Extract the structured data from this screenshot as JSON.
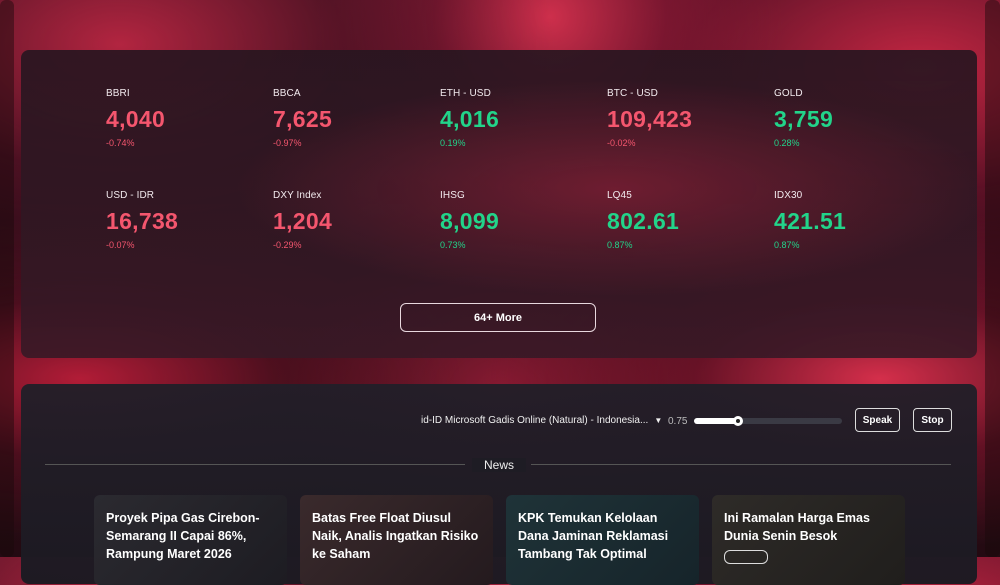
{
  "tickers": [
    {
      "symbol": "BBRI",
      "price": "4,040",
      "change": "-0.74%",
      "direction": "down"
    },
    {
      "symbol": "BBCA",
      "price": "7,625",
      "change": "-0.97%",
      "direction": "down"
    },
    {
      "symbol": "ETH - USD",
      "price": "4,016",
      "change": "0.19%",
      "direction": "up"
    },
    {
      "symbol": "BTC - USD",
      "price": "109,423",
      "change": "-0.02%",
      "direction": "down"
    },
    {
      "symbol": "GOLD",
      "price": "3,759",
      "change": "0.28%",
      "direction": "up"
    },
    {
      "symbol": "USD - IDR",
      "price": "16,738",
      "change": "-0.07%",
      "direction": "down"
    },
    {
      "symbol": "DXY Index",
      "price": "1,204",
      "change": "-0.29%",
      "direction": "down"
    },
    {
      "symbol": "IHSG",
      "price": "8,099",
      "change": "0.73%",
      "direction": "up"
    },
    {
      "symbol": "LQ45",
      "price": "802.61",
      "change": "0.87%",
      "direction": "up"
    },
    {
      "symbol": "IDX30",
      "price": "421.51",
      "change": "0.87%",
      "direction": "up"
    }
  ],
  "more_button": {
    "label": "64+ More"
  },
  "tts": {
    "voice": "id-ID Microsoft Gadis Online (Natural) - Indonesia...",
    "rate": "0.75",
    "rate_fraction": 0.3,
    "speak_label": "Speak",
    "stop_label": "Stop"
  },
  "news": {
    "section_title": "News",
    "cards": [
      {
        "title": "Proyek Pipa Gas Cirebon-Semarang II Capai 86%, Rampung Maret 2026"
      },
      {
        "title": "Batas Free Float Diusul Naik, Analis Ingatkan Risiko ke Saham"
      },
      {
        "title": "KPK Temukan Kelolaan Dana Jaminan Reklamasi Tambang Tak Optimal"
      },
      {
        "title": "Ini Ramalan Harga Emas Dunia Senin Besok"
      }
    ]
  },
  "colors": {
    "up": "#22d48a",
    "down": "#f4566e"
  }
}
